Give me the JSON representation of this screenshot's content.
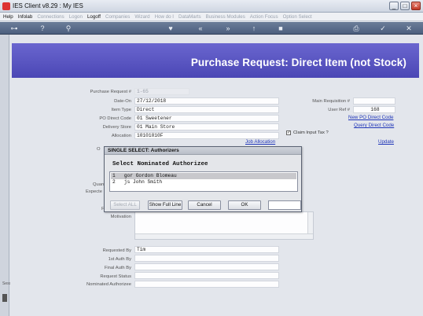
{
  "window": {
    "title": "IES Client v8.29 : My IES",
    "controls": [
      "_",
      "□",
      "×"
    ]
  },
  "menu": {
    "items": [
      {
        "label": "Help",
        "enabled": true
      },
      {
        "label": "Infolab",
        "enabled": true
      },
      {
        "label": "Connections",
        "enabled": false
      },
      {
        "label": "Logon",
        "enabled": false
      },
      {
        "label": "Logoff",
        "enabled": true
      },
      {
        "label": "Companies",
        "enabled": false
      },
      {
        "label": "Wizard",
        "enabled": false
      },
      {
        "label": "How do I",
        "enabled": false
      },
      {
        "label": "DataMarts",
        "enabled": false
      },
      {
        "label": "Business Modules",
        "enabled": false
      },
      {
        "label": "Action Focus",
        "enabled": false
      },
      {
        "label": "Option Select",
        "enabled": false
      }
    ]
  },
  "toolbar": {
    "icons": [
      "key-icon",
      "help-icon",
      "search-icon",
      "heart-icon",
      "refresh-icon",
      "back-icon",
      "forward-icon",
      "upload-icon",
      "stop-icon",
      "print-icon",
      "check-icon",
      "close-icon"
    ]
  },
  "page": {
    "title": "Purchase Request: Direct Item (not Stock)"
  },
  "form": {
    "purchase_request_label": "Purchase Request #",
    "purchase_request_value": "1-65",
    "date_on_label": "Date-On",
    "date_on_value": "27/12/2018",
    "item_type_label": "Item Type",
    "item_type_value": "Direct",
    "po_direct_code_label": "PO Direct Code",
    "po_direct_code_value": "01 Sweetener",
    "delivery_store_label": "Delivery Store",
    "delivery_store_value": "01 Main Store",
    "allocation_label": "Allocation",
    "allocation_value": "10101010F",
    "main_requisition_label": "Main Requisition #",
    "main_requisition_value": "",
    "user_ref_label": "User Ref #",
    "user_ref_value": "168",
    "new_po_direct_code_link": "New PO Direct Code",
    "query_direct_code_link": "Query Direct Code",
    "claim_input_tax_label": "Claim Input Tax ?",
    "claim_input_tax_checked": true,
    "job_allocation_link": "Job Allocation",
    "update_link": "Update",
    "partial_label_1": "O",
    "partial_label_2": "Quan",
    "partial_label_3": "Expecte",
    "partial_label_4": "F",
    "motivation_label": "Motivation",
    "requested_by_label": "Requested By",
    "requested_by_value": "Tim",
    "first_auth_label": "1st Auth By",
    "final_auth_label": "Final Auth By",
    "request_status_label": "Request Status",
    "nominated_authorizee_label": "Nominated Authorizee"
  },
  "dialog": {
    "title": "SINGLE SELECT: Authorizers",
    "heading": "Select Nominated Authorizee",
    "rows": [
      {
        "text": "1   gor Gordon Blomeau",
        "selected": true
      },
      {
        "text": "2   js John Smith",
        "selected": false
      }
    ],
    "buttons": {
      "select_all": "Select ALL",
      "show_full_line": "Show Full Line",
      "cancel": "Cancel",
      "ok": "OK"
    },
    "input_value": ""
  },
  "left_strip": {
    "label": "Sess"
  }
}
